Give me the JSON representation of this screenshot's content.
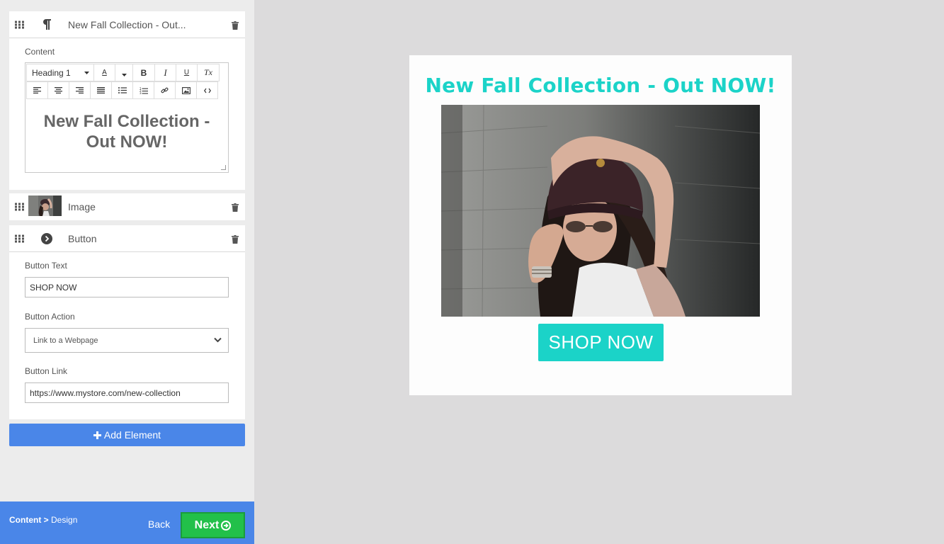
{
  "sidebar": {
    "content_panel": {
      "title": "New Fall Collection - Out...",
      "content_label": "Content",
      "format_select": "Heading 1",
      "toolbar_bold": "B",
      "toolbar_italic": "I",
      "toolbar_underline": "U",
      "toolbar_clear": "Tx",
      "toolbar_font_color": "A",
      "editor_text": "New Fall Collection - Out NOW!"
    },
    "image_panel": {
      "title": "Image"
    },
    "button_panel": {
      "title": "Button",
      "button_text_label": "Button Text",
      "button_text_value": "SHOP NOW",
      "button_action_label": "Button Action",
      "button_action_value": "Link to a Webpage",
      "button_link_label": "Button Link",
      "button_link_value": "https://www.mystore.com/new-collection"
    },
    "add_element": "Add Element"
  },
  "footer": {
    "breadcrumb_current": "Content >",
    "breadcrumb_next": "Design",
    "back_label": "Back",
    "next_label": "Next"
  },
  "preview": {
    "title": "New Fall Collection - Out NOW!",
    "button_label": "SHOP NOW"
  },
  "colors": {
    "accent_blue": "#4a86e8",
    "next_green": "#22c04a",
    "preview_teal": "#1bd3c8"
  },
  "icons": [
    "drag-handle-icon",
    "paragraph-icon",
    "trash-icon",
    "play-circle-icon",
    "plus-icon",
    "arrow-circle-right-icon",
    "chevron-down-icon"
  ]
}
